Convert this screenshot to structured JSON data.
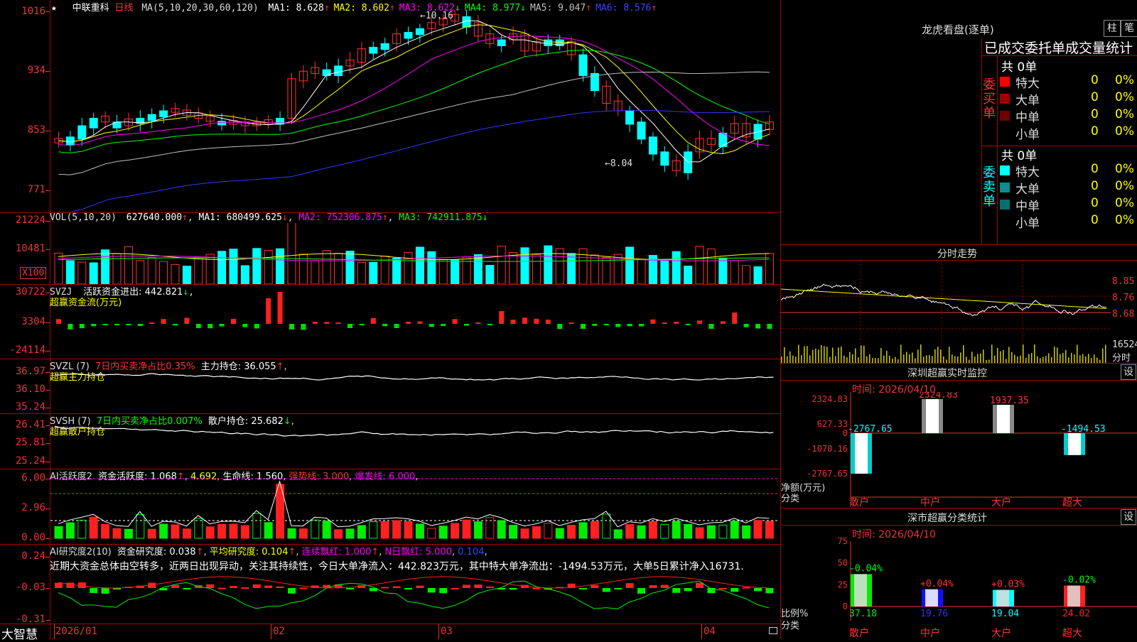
{
  "main_chart": {
    "star": "★",
    "stock_name": "中联重科",
    "period": "日线",
    "ma_header": "MA(5,10,20,30,60,120)",
    "ma": [
      {
        "label": "MA1: 8.628",
        "color": "#ffffff",
        "arrow": "↑"
      },
      {
        "label": "MA2: 8.602",
        "color": "#ffff00",
        "arrow": "↑"
      },
      {
        "label": "MA3: 8.622",
        "color": "#ff00ff",
        "arrow": "↓"
      },
      {
        "label": "MA4: 8.977",
        "color": "#00ff00",
        "arrow": "↓"
      },
      {
        "label": "MA5: 9.047",
        "color": "#c0c0c0",
        "arrow": "↑"
      },
      {
        "label": "MA6: 8.576",
        "color": "#4040ff",
        "arrow": "↑"
      }
    ],
    "y_labels": [
      "1016",
      "934",
      "853",
      "771"
    ],
    "high_mark": "10.16",
    "low_mark": "8.04"
  },
  "vol_pane": {
    "title": "VOL(5,10,20)",
    "value": "627640.000",
    "ma1": "MA1: 680499.625",
    "ma2": "MA2: 752306.875",
    "ma3": "MA3: 742911.875",
    "y_labels": [
      "21224",
      "10481"
    ],
    "unit": "X100"
  },
  "svzj_pane": {
    "title": "SVZJ",
    "line1": "活跃资金进出: 442.821",
    "line2": "超赢资金流(万元)",
    "y_labels": [
      "30722",
      "3304",
      "-24114"
    ]
  },
  "svzl_pane": {
    "title": "SVZL (7)",
    "ratio": "7日内买卖净占比0.35%",
    "hold": "主力持仓: 36.055",
    "line2": "超赢主力持仓",
    "y_labels": [
      "36.97",
      "36.10",
      "35.24"
    ]
  },
  "svsh_pane": {
    "title": "SVSH (7)",
    "ratio": "7日内买卖净占比0.007%",
    "hold": "散户持仓: 25.682",
    "line2": "超赢散户持仓",
    "y_labels": [
      "26.41",
      "25.81",
      "25.24"
    ]
  },
  "ai_active_pane": {
    "title": "AI活跃度2",
    "active": "资金活跃度: 1.068",
    "v2": "4.692",
    "life": "生命线: 1.560",
    "strong": "强势线: 3.000",
    "burst": "爆发线: 6.000",
    "y_labels": [
      "6.00",
      "2.96",
      "0.00"
    ]
  },
  "ai_research_pane": {
    "title": "AI研究度2(10)",
    "research": "资金研究度: 0.038",
    "avg": "平均研究度: 0.104",
    "cont": "连续飘红: 1.000",
    "nday": "N日飘红: 5.000",
    "v5": "0.104",
    "comment": "近期大资金总体由空转多，近两日出现异动，关注其持续性，今日大单净流入：442.823万元，其中特大单净流出：-1494.53万元，大单5日累计净入16731.",
    "y_labels": [
      "0.24",
      "-0.03",
      "-0.31"
    ]
  },
  "date_axis": {
    "brand": "大智慧",
    "labels": [
      "2026/01",
      "02",
      "03",
      "04"
    ]
  },
  "dragon_tiger": {
    "title": "龙虎看盘(逐单)",
    "btn_bar": "柱",
    "btn_pen": "笔",
    "subtitle": "已成交委托单成交量统计",
    "buy": {
      "side_label": "委买单",
      "total": "共 0单",
      "rows": [
        {
          "name": "特大",
          "count": "0",
          "pct": "0%",
          "color": "#ff0000"
        },
        {
          "name": "大单",
          "count": "0",
          "pct": "0%",
          "color": "#a00000"
        },
        {
          "name": "中单",
          "count": "0",
          "pct": "0%",
          "color": "#700000"
        },
        {
          "name": "小单",
          "count": "0",
          "pct": "0%",
          "color": "#000000"
        }
      ]
    },
    "sell": {
      "side_label": "委卖单",
      "total": "共 0单",
      "rows": [
        {
          "name": "特大",
          "count": "0",
          "pct": "0%",
          "color": "#00ffff"
        },
        {
          "name": "大单",
          "count": "0",
          "pct": "0%",
          "color": "#009090"
        },
        {
          "name": "中单",
          "count": "0",
          "pct": "0%",
          "color": "#007070"
        },
        {
          "name": "小单",
          "count": "0",
          "pct": "0%",
          "color": "#000000"
        }
      ]
    }
  },
  "intraday": {
    "title": "分时走势",
    "y_labels": [
      "8.85",
      "8.76",
      "8.68"
    ],
    "vol_label": "16524",
    "vol_unit": "分时"
  },
  "sz_monitor": {
    "title": "深圳超赢实时监控",
    "btn": "设",
    "time": "时间: 2026/04/10",
    "y_labels": [
      "2324.83",
      "627.33",
      "0",
      "-1070.16",
      "-2767.65"
    ],
    "unit_line1": "净额(万元)",
    "unit_line2": "分类",
    "chart_data": {
      "type": "bar",
      "categories": [
        "散户",
        "中户",
        "大户",
        "超大"
      ],
      "values": [
        -2767.65,
        2324.83,
        1937.35,
        -1494.53
      ],
      "value_labels": [
        "-2767.65",
        "2324.83",
        "1937.35",
        "-1494.53"
      ],
      "ylim": [
        -2767.65,
        2324.83
      ]
    }
  },
  "sz_class": {
    "title": "深市超赢分类统计",
    "btn": "设",
    "time": "时间: 2026/04/10",
    "y_labels": [
      "75",
      "50",
      "25",
      "0"
    ],
    "unit_line1": "比例%",
    "unit_line2": "分类",
    "chart_data": {
      "type": "bar",
      "categories": [
        "散户",
        "中户",
        "大户",
        "超大"
      ],
      "values": [
        37.18,
        19.76,
        19.04,
        24.02
      ],
      "value_labels": [
        "37.18",
        "19.76",
        "19.04",
        "24.02"
      ],
      "change_labels": [
        "-0.04%",
        "+0.04%",
        "+0.03%",
        "-0.02%"
      ],
      "ylim": [
        0,
        75
      ]
    }
  }
}
